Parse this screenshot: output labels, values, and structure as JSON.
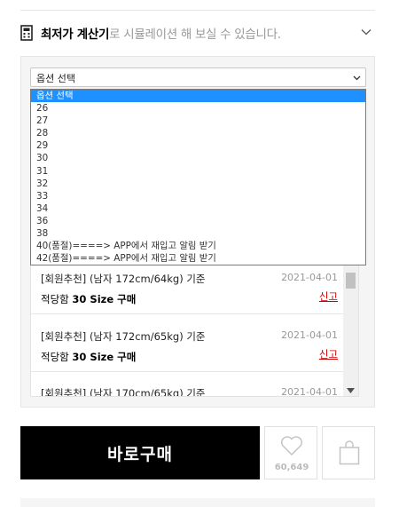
{
  "calculator": {
    "title_bold": "최저가 계산기",
    "title_rest": "로 시뮬레이션 해 보실 수 있습니다.",
    "icon": "calculator-icon",
    "toggle_icon": "chevron-down-icon"
  },
  "option_select": {
    "selected": "옵션 선택",
    "options": [
      "옵션 선택",
      "26",
      "27",
      "28",
      "29",
      "30",
      "31",
      "32",
      "33",
      "34",
      "36",
      "38",
      "40(품절)====> APP에서 재입고 알림 받기",
      "42(품절)====> APP에서 재입고 알림 받기"
    ],
    "highlighted_index": 0
  },
  "reviews": [
    {
      "meta": "[회원추천] (남자 172cm/64kg) 기준",
      "date": "2021-04-01",
      "fit_prefix": "적당함",
      "fit_size": "30 Size 구매",
      "report": "신고"
    },
    {
      "meta": "[회원추천] (남자 172cm/65kg) 기준",
      "date": "2021-04-01",
      "fit_prefix": "적당함",
      "fit_size": "30 Size 구매",
      "report": "신고"
    },
    {
      "meta": "[회원추천] (남자 170cm/65kg) 기준",
      "date": "2021-04-01"
    }
  ],
  "actions": {
    "buy_label": "바로구매",
    "like_count": "60,649",
    "like_icon": "heart-icon",
    "bag_icon": "shopping-bag-icon"
  }
}
